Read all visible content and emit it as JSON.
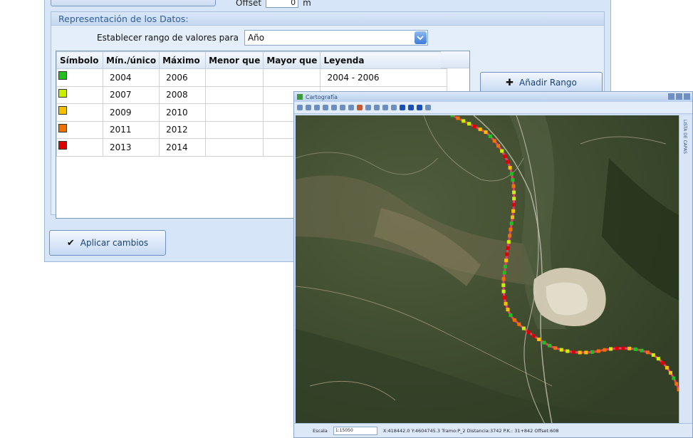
{
  "offset": {
    "label": "Offset",
    "value": "0",
    "unit": "m"
  },
  "data_section": {
    "title": "Representación de los Datos:",
    "range_label": "Establecer rango de valores para",
    "range_field": "Año"
  },
  "table": {
    "headers": [
      "Símbolo",
      "Mín./único",
      "Máximo",
      "Menor que",
      "Mayor que",
      "Leyenda"
    ],
    "rows": [
      {
        "color": "#20c020",
        "min": "2004",
        "max": "2006",
        "less": "",
        "greater": "",
        "legend": "2004 - 2006"
      },
      {
        "color": "#c8f000",
        "min": "2007",
        "max": "2008",
        "less": "",
        "greater": "",
        "legend": ""
      },
      {
        "color": "#f5c000",
        "min": "2009",
        "max": "2010",
        "less": "",
        "greater": "",
        "legend": ""
      },
      {
        "color": "#f07000",
        "min": "2011",
        "max": "2012",
        "less": "",
        "greater": "",
        "legend": ""
      },
      {
        "color": "#e00000",
        "min": "2013",
        "max": "2014",
        "less": "",
        "greater": "",
        "legend": ""
      }
    ]
  },
  "buttons": {
    "add_range": "Añadir Rango",
    "apply": "Aplicar cambios"
  },
  "map_window": {
    "title": "Cartografía",
    "side_tab": "LISTA DE CAPAS",
    "scale_label": "Escala",
    "scale_value": "1:15050",
    "status_text": "X:418442.0  Y:4604745.3  Tramo:P_2  Distancia:3742  P.K.: 31+842  Offset:608"
  },
  "icons": [
    "chevron-down-icon",
    "plus-icon",
    "checkmark-icon",
    "app-logo-icon"
  ],
  "colors": {
    "accent": "#2f5e99",
    "window_bg": "#d6e5f7",
    "route_line": "#e0406a"
  }
}
